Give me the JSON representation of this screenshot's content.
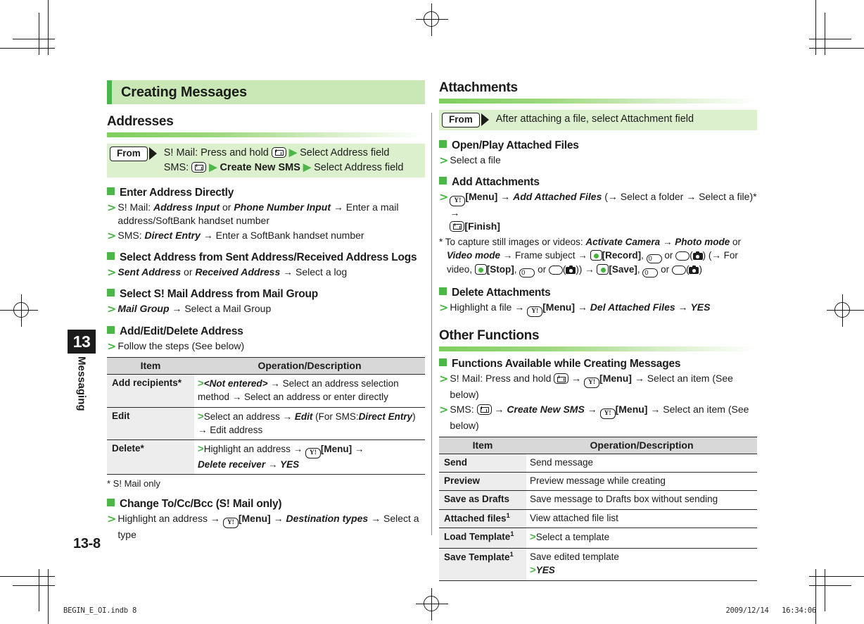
{
  "page": {
    "number": "13-8",
    "chapter_number": "13",
    "chapter_label": "Messaging",
    "footer_left": "BEGIN_E_OI.indb   8",
    "footer_right": "2009/12/14   16:34:06",
    "accent_green": "#4cb648",
    "header_bar_green": "#c9e8b5",
    "frombox_green": "#ddf0cd"
  },
  "left": {
    "chapter_title": "Creating Messages",
    "addresses": {
      "heading": "Addresses",
      "from_badge": "From",
      "from_line1_a": "S! Mail: Press and hold",
      "from_line1_b": "Select Address field",
      "from_line2_a": "SMS:",
      "from_line2_b": "Create New SMS",
      "from_line2_c": "Select Address field",
      "sub1": {
        "title": "Enter Address Directly",
        "b1_a": "S! Mail:",
        "b1_bold1": "Address Input",
        "b1_or": "or",
        "b1_bold2": "Phone Number Input",
        "b1_tail": "Enter a mail address/SoftBank handset number",
        "b2_a": "SMS:",
        "b2_bold": "Direct Entry",
        "b2_tail": "Enter a SoftBank handset number"
      },
      "sub2": {
        "title": "Select Address from Sent Address/Received Address Logs",
        "b1_bold1": "Sent Address",
        "b1_or": "or",
        "b1_bold2": "Received Address",
        "b1_tail": "Select a log"
      },
      "sub3": {
        "title": "Select S! Mail Address from Mail Group",
        "b1_bold": "Mail Group",
        "b1_tail": "Select a Mail Group"
      },
      "sub4": {
        "title": "Add/Edit/Delete Address",
        "b1": "Follow the steps (See below)"
      },
      "table": {
        "headers": [
          "Item",
          "Operation/Description"
        ],
        "rows": [
          {
            "item": "Add recipients*",
            "bullet": true,
            "desc_bold": "<Not entered>",
            "desc_tail": "Select an address selection method → Select an address or enter directly"
          },
          {
            "item": "Edit",
            "bullet": true,
            "desc_pre": "Select an address →",
            "desc_bold1": "Edit",
            "desc_mid": "(For SMS:",
            "desc_bold2": "Direct Entry",
            "desc_tail": ") → Edit address"
          },
          {
            "item": "Delete*",
            "bullet": true,
            "desc_pre": "Highlight an address →",
            "desc_key": "[Menu]",
            "desc_bold1": "Delete receiver",
            "desc_bold2": "YES"
          }
        ],
        "footnote": "* S! Mail only"
      },
      "sub5": {
        "title": "Change To/Cc/Bcc (S! Mail only)",
        "b1_pre": "Highlight an address →",
        "b1_key": "[Menu]",
        "b1_bold": "Destination types",
        "b1_tail": "Select a type"
      }
    }
  },
  "right": {
    "attachments": {
      "heading": "Attachments",
      "from_badge": "From",
      "from_text": "After attaching a file, select Attachment field",
      "sub1": {
        "title": "Open/Play Attached Files",
        "b1": "Select a file"
      },
      "sub2": {
        "title": "Add Attachments",
        "b1_key1": "[Menu]",
        "b1_bold": "Add Attached Files",
        "b1_mid": "(→ Select a folder → Select a file)* →",
        "b1_key2": "[Finish]",
        "note_pre": "* To capture still images or videos:",
        "note_bold1": "Activate Camera",
        "note_bold2": "Photo mode",
        "note_or": "or",
        "note_bold3": "Video mode",
        "note_mid": "→ Frame subject →",
        "note_record": "[Record]",
        "note_for": "(→ For video,",
        "note_stop": "[Stop]",
        "note_save": "[Save]",
        "note_zero": "0",
        "note_or2": "or"
      },
      "sub3": {
        "title": "Delete Attachments",
        "b1_pre": "Highlight a file →",
        "b1_key": "[Menu]",
        "b1_bold1": "Del Attached Files",
        "b1_bold2": "YES"
      }
    },
    "other_functions": {
      "heading": "Other Functions",
      "sub1": {
        "title": "Functions Available while Creating Messages",
        "b1_pre": "S! Mail: Press and hold",
        "b1_key": "[Menu]",
        "b1_tail": "Select an item (See below)",
        "b2_pre": "SMS:",
        "b2_bold": "Create New SMS",
        "b2_key": "[Menu]",
        "b2_tail": "Select an item (See below)"
      },
      "table": {
        "headers": [
          "Item",
          "Operation/Description"
        ],
        "rows": [
          {
            "item": "Send",
            "desc": "Send message"
          },
          {
            "item": "Preview",
            "desc": "Preview message while creating"
          },
          {
            "item": "Save as Drafts",
            "desc": "Save message to Drafts box without sending"
          },
          {
            "item": "Attached files",
            "sup": "1",
            "desc": "View attached file list"
          },
          {
            "item": "Load Template",
            "sup": "1",
            "bullet": true,
            "desc": "Select a template"
          },
          {
            "item": "Save Template",
            "sup": "1",
            "desc": "Save edited template",
            "bullet2_bold": "YES"
          }
        ]
      }
    }
  }
}
